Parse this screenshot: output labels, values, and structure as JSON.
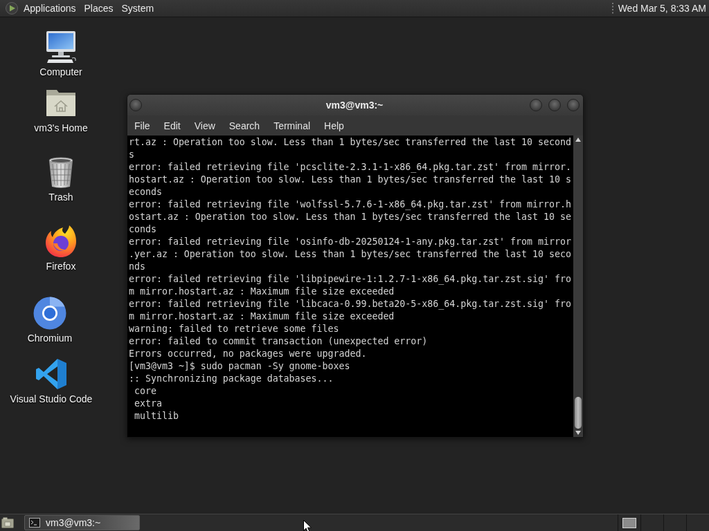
{
  "top_panel": {
    "menus": [
      "Applications",
      "Places",
      "System"
    ],
    "clock": "Wed Mar 5, 8:33 AM"
  },
  "desktop_icons": [
    {
      "label": "Computer",
      "kind": "monitor"
    },
    {
      "label": "vm3's Home",
      "kind": "folder"
    },
    {
      "label": "Trash",
      "kind": "trash"
    },
    {
      "label": "Firefox",
      "kind": "flame"
    },
    {
      "label": "Chromium",
      "kind": "ring"
    },
    {
      "label": "Visual Studio Code",
      "kind": "ribbon"
    }
  ],
  "terminal_window": {
    "title": "vm3@vm3:~",
    "menu": [
      "File",
      "Edit",
      "View",
      "Search",
      "Terminal",
      "Help"
    ],
    "lines": [
      "rt.az : Operation too slow. Less than 1 bytes/sec transferred the last 10 second",
      "s",
      "error: failed retrieving file 'pcsclite-2.3.1-1-x86_64.pkg.tar.zst' from mirror.",
      "hostart.az : Operation too slow. Less than 1 bytes/sec transferred the last 10 s",
      "econds",
      "error: failed retrieving file 'wolfssl-5.7.6-1-x86_64.pkg.tar.zst' from mirror.h",
      "ostart.az : Operation too slow. Less than 1 bytes/sec transferred the last 10 se",
      "conds",
      "error: failed retrieving file 'osinfo-db-20250124-1-any.pkg.tar.zst' from mirror",
      ".yer.az : Operation too slow. Less than 1 bytes/sec transferred the last 10 seco",
      "nds",
      "error: failed retrieving file 'libpipewire-1:1.2.7-1-x86_64.pkg.tar.zst.sig' fro",
      "m mirror.hostart.az : Maximum file size exceeded",
      "error: failed retrieving file 'libcaca-0.99.beta20-5-x86_64.pkg.tar.zst.sig' fro",
      "m mirror.hostart.az : Maximum file size exceeded",
      "warning: failed to retrieve some files",
      "error: failed to commit transaction (unexpected error)",
      "Errors occurred, no packages were upgraded.",
      "[vm3@vm3 ~]$ sudo pacman -Sy gnome-boxes",
      ":: Synchronizing package databases...",
      " core",
      " extra",
      " multilib"
    ]
  },
  "taskbar": {
    "tasks": [
      {
        "label": "vm3@vm3:~",
        "selected": true
      }
    ]
  }
}
